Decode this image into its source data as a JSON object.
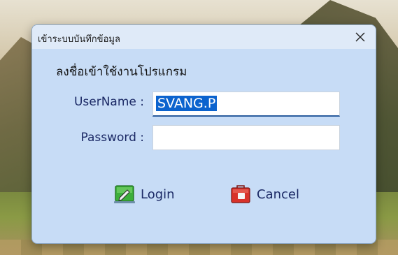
{
  "dialog": {
    "title": "เข้าระบบบันทึกข้อมูล",
    "heading": "ลงชื่อเข้าใช้งานโปรแกรม"
  },
  "form": {
    "username_label": "UserName :",
    "username_value": "SVANG.P",
    "password_label": "Password :",
    "password_value": ""
  },
  "buttons": {
    "login_label": "Login",
    "cancel_label": "Cancel"
  },
  "icons": {
    "close": "close-icon",
    "login": "login-icon",
    "cancel": "cancel-icon"
  },
  "colors": {
    "dialog_bg": "#c7dcf6",
    "titlebar_bg": "#dfeaf8",
    "label_text": "#1c2a66",
    "selection": "#0b63ce"
  }
}
